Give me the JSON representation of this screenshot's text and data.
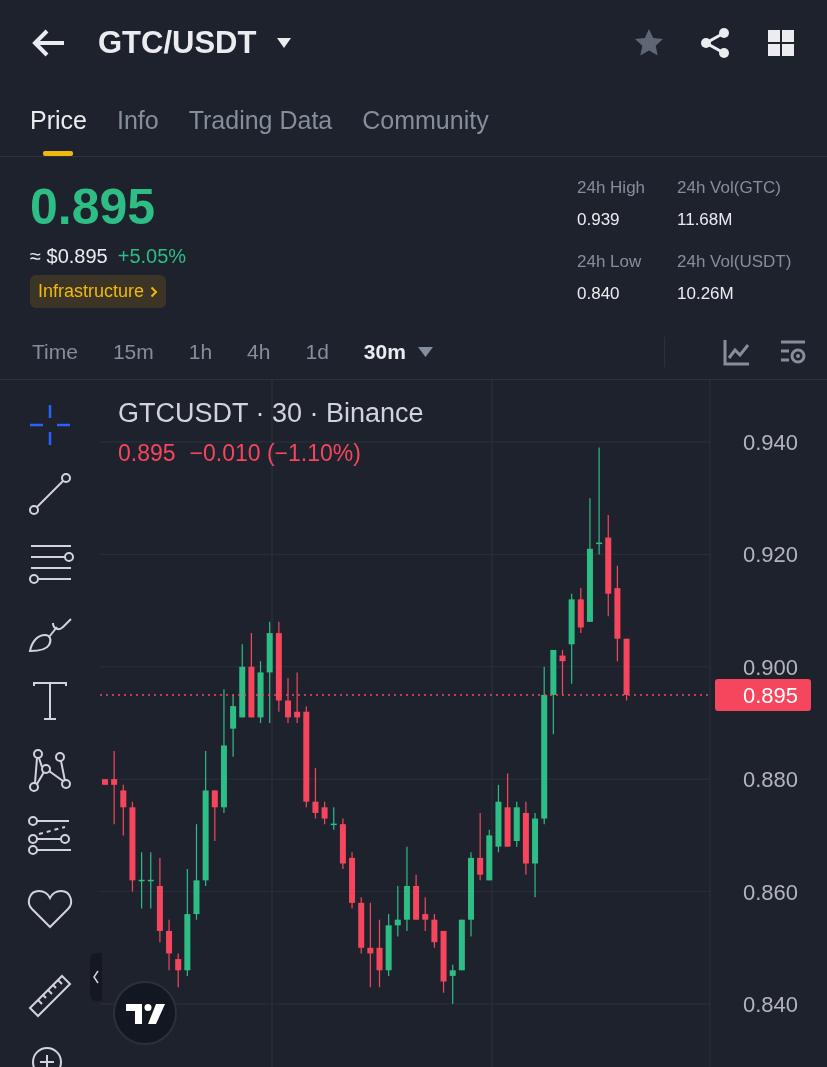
{
  "header": {
    "title": "GTC/USDT",
    "favorite": false
  },
  "tabs": [
    {
      "label": "Price",
      "selected": true
    },
    {
      "label": "Info",
      "selected": false
    },
    {
      "label": "Trading Data",
      "selected": false
    },
    {
      "label": "Community",
      "selected": false
    }
  ],
  "price": {
    "last": "0.895",
    "fiat": "≈ $0.895",
    "change": "+5.05%",
    "tag": "Infrastructure"
  },
  "stats": [
    {
      "label": "24h High",
      "value": "0.939"
    },
    {
      "label": "24h Vol(GTC)",
      "value": "11.68M"
    },
    {
      "label": "24h Low",
      "value": "0.840"
    },
    {
      "label": "24h Vol(USDT)",
      "value": "10.26M"
    }
  ],
  "intervals": [
    {
      "label": "Time",
      "selected": false,
      "dropdown": false
    },
    {
      "label": "15m",
      "selected": false,
      "dropdown": false
    },
    {
      "label": "1h",
      "selected": false,
      "dropdown": false
    },
    {
      "label": "4h",
      "selected": false,
      "dropdown": false
    },
    {
      "label": "1d",
      "selected": false,
      "dropdown": false
    },
    {
      "label": "30m",
      "selected": true,
      "dropdown": true
    }
  ],
  "tools": [
    {
      "kind": "crosshair",
      "selected": true
    },
    {
      "kind": "trendline",
      "selected": false
    },
    {
      "kind": "hlines",
      "selected": false
    },
    {
      "kind": "brush",
      "selected": false
    },
    {
      "kind": "text",
      "selected": false
    },
    {
      "kind": "pattern",
      "selected": false
    },
    {
      "kind": "fib",
      "selected": false
    },
    {
      "kind": "heart",
      "selected": false
    },
    {
      "kind": "ruler",
      "selected": false
    },
    {
      "kind": "zoom",
      "selected": false
    }
  ],
  "chart": {
    "legend": "GTCUSDT · 30 · Binance",
    "last": "0.895",
    "change": "−0.010 (−1.10%)",
    "axis_labels": [
      "0.940",
      "0.920",
      "0.900",
      "0.880",
      "0.860",
      "0.840"
    ],
    "price_tag": "0.895"
  }
}
